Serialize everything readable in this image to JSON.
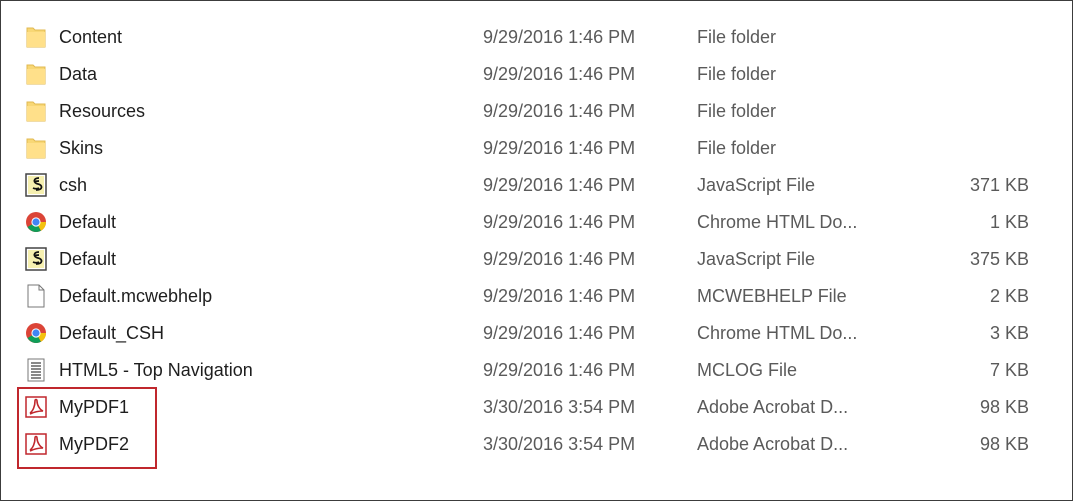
{
  "files": [
    {
      "name": "Content",
      "date": "9/29/2016 1:46 PM",
      "type": "File folder",
      "size": "",
      "icon": "folder-icon"
    },
    {
      "name": "Data",
      "date": "9/29/2016 1:46 PM",
      "type": "File folder",
      "size": "",
      "icon": "folder-icon"
    },
    {
      "name": "Resources",
      "date": "9/29/2016 1:46 PM",
      "type": "File folder",
      "size": "",
      "icon": "folder-icon"
    },
    {
      "name": "Skins",
      "date": "9/29/2016 1:46 PM",
      "type": "File folder",
      "size": "",
      "icon": "folder-icon"
    },
    {
      "name": "csh",
      "date": "9/29/2016 1:46 PM",
      "type": "JavaScript File",
      "size": "371 KB",
      "icon": "javascript-file-icon"
    },
    {
      "name": "Default",
      "date": "9/29/2016 1:46 PM",
      "type": "Chrome HTML Do...",
      "size": "1 KB",
      "icon": "chrome-icon"
    },
    {
      "name": "Default",
      "date": "9/29/2016 1:46 PM",
      "type": "JavaScript File",
      "size": "375 KB",
      "icon": "javascript-file-icon"
    },
    {
      "name": "Default.mcwebhelp",
      "date": "9/29/2016 1:46 PM",
      "type": "MCWEBHELP File",
      "size": "2 KB",
      "icon": "blank-file-icon"
    },
    {
      "name": "Default_CSH",
      "date": "9/29/2016 1:46 PM",
      "type": "Chrome HTML Do...",
      "size": "3 KB",
      "icon": "chrome-icon"
    },
    {
      "name": "HTML5 - Top Navigation",
      "date": "9/29/2016 1:46 PM",
      "type": "MCLOG File",
      "size": "7 KB",
      "icon": "log-file-icon"
    },
    {
      "name": "MyPDF1",
      "date": "3/30/2016 3:54 PM",
      "type": "Adobe Acrobat D...",
      "size": "98 KB",
      "icon": "pdf-file-icon"
    },
    {
      "name": "MyPDF2",
      "date": "3/30/2016 3:54 PM",
      "type": "Adobe Acrobat D...",
      "size": "98 KB",
      "icon": "pdf-file-icon"
    }
  ],
  "colors": {
    "folder": "#f8d775",
    "highlight": "#c0272d",
    "pdf": "#c0272d"
  }
}
